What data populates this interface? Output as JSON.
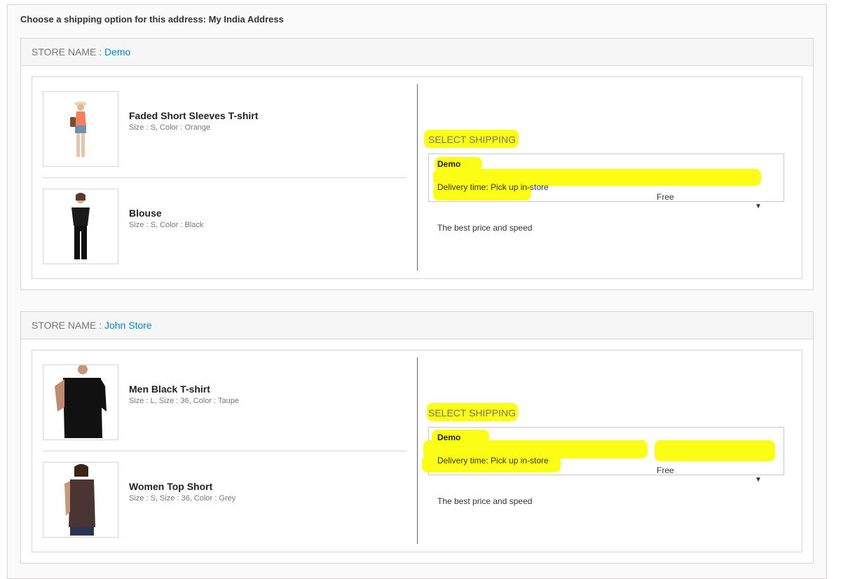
{
  "address_prompt": "Choose a shipping option for this address: My India Address",
  "stores": [
    {
      "store_label": "STORE NAME :",
      "store_name": "Demo",
      "products": [
        {
          "name": "Faded Short Sleeves T-shirt",
          "attributes": "Size : S, Color : Orange"
        },
        {
          "name": "Blouse",
          "attributes": "Size : S, Color : Black"
        }
      ],
      "shipping": {
        "title": "SELECT SHIPPING",
        "carrier": "Demo",
        "delivery": "Delivery time: Pick up in-store",
        "price": "Free",
        "description": "The best price and speed"
      }
    },
    {
      "store_label": "STORE NAME :",
      "store_name": "John Store",
      "products": [
        {
          "name": "Men Black T-shirt",
          "attributes": "Size : L, Size : 36, Color : Taupe"
        },
        {
          "name": "Women Top Short",
          "attributes": "Size : S, Size : 36, Color : Grey"
        }
      ],
      "shipping": {
        "title": "SELECT SHIPPING",
        "carrier": "Demo",
        "delivery": "Delivery time: Pick up in-store",
        "price": "Free",
        "description": "The best price and speed"
      }
    }
  ],
  "colors": {
    "link": "#0088cc",
    "highlight": "#fbfd14",
    "border": "#d6d4d4"
  }
}
